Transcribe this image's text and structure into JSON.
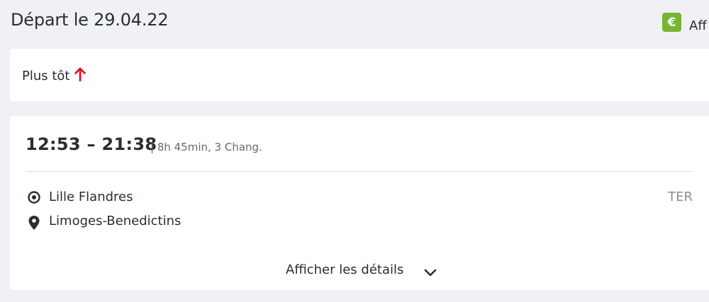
{
  "header": {
    "title": "Départ le 29.04.22",
    "price_badge_symbol": "€",
    "price_label": "Aff",
    "badge_color": "#78b433"
  },
  "earlier": {
    "label": "Plus tôt",
    "arrow_icon": "arrow-up-icon",
    "arrow_color": "#ec0016"
  },
  "journey": {
    "times": "12:53 – 21:38",
    "duration": "| 8h 45min, 3 Chang.",
    "origin": {
      "icon": "origin-target-icon",
      "name": "Lille Flandres"
    },
    "destination": {
      "icon": "location-pin-icon",
      "name": "Limoges-Benedictins"
    },
    "product": "TER",
    "details_label": "Afficher les détails",
    "details_icon": "chevron-down-icon"
  }
}
